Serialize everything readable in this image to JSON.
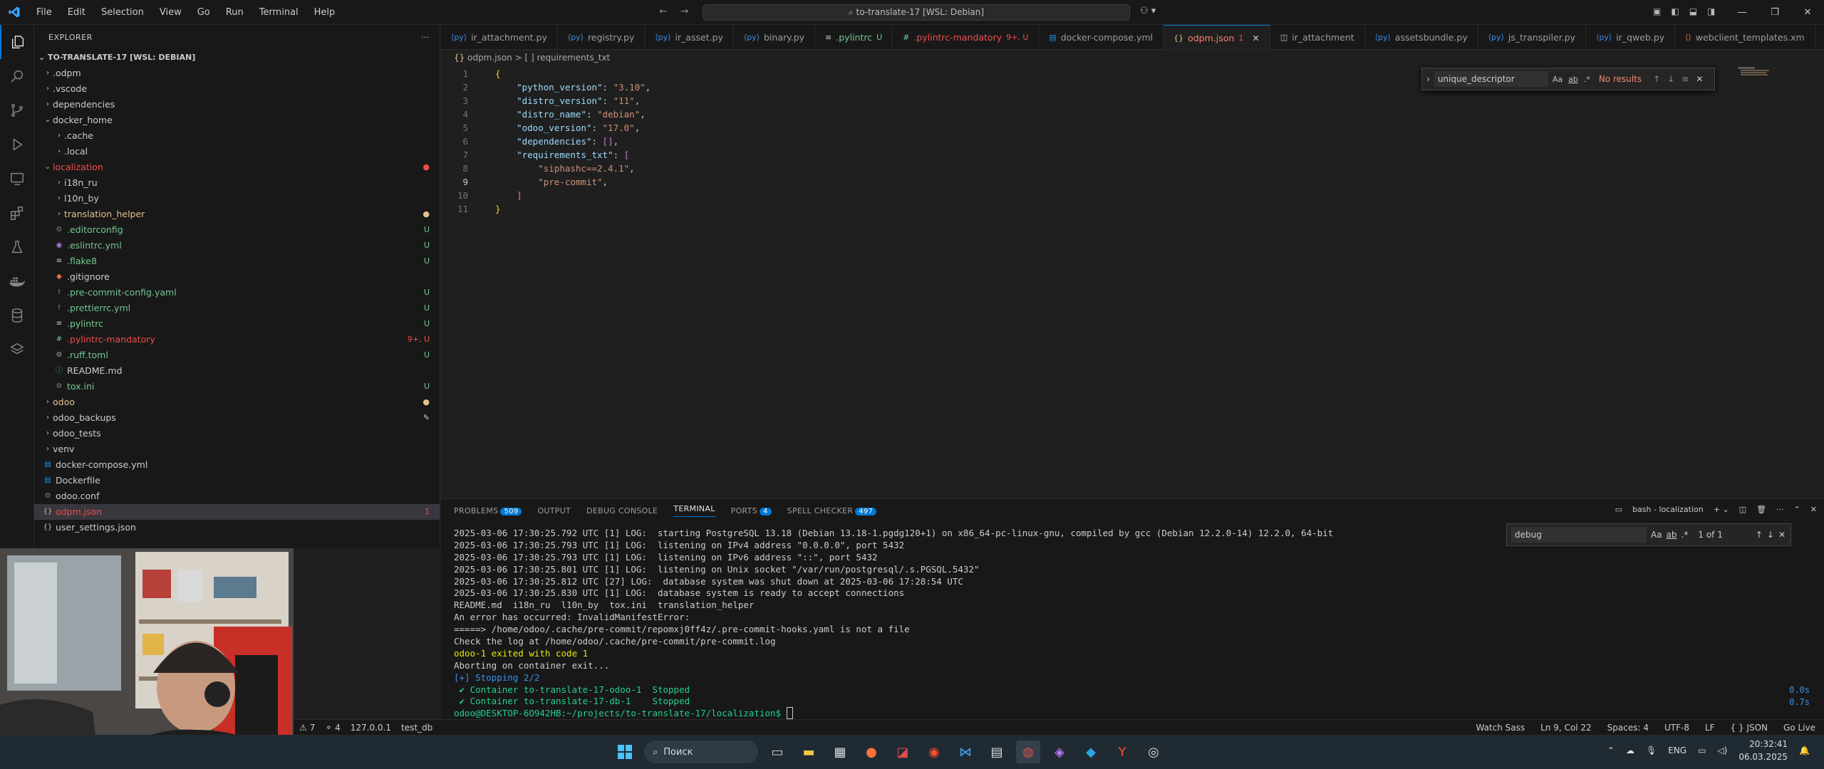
{
  "titlebar": {
    "menu": [
      "File",
      "Edit",
      "Selection",
      "View",
      "Go",
      "Run",
      "Terminal",
      "Help"
    ],
    "command_center": "to-translate-17 [WSL: Debian]"
  },
  "explorer": {
    "title": "EXPLORER",
    "root": "TO-TRANSLATE-17 [WSL: DEBIAN]",
    "items": [
      {
        "label": ".odpm",
        "indent": 1,
        "type": "folder",
        "open": false,
        "color": "white",
        "badge": ""
      },
      {
        "label": ".vscode",
        "indent": 1,
        "type": "folder",
        "open": false,
        "color": "white",
        "badge": ""
      },
      {
        "label": "dependencies",
        "indent": 1,
        "type": "folder",
        "open": false,
        "color": "white",
        "badge": ""
      },
      {
        "label": "docker_home",
        "indent": 1,
        "type": "folder",
        "open": true,
        "color": "white",
        "badge": ""
      },
      {
        "label": ".cache",
        "indent": 2,
        "type": "folder",
        "open": false,
        "color": "white",
        "badge": ""
      },
      {
        "label": ".local",
        "indent": 2,
        "type": "folder",
        "open": false,
        "color": "white",
        "badge": ""
      },
      {
        "label": "localization",
        "indent": 1,
        "type": "folder",
        "open": true,
        "color": "red",
        "badge": "●"
      },
      {
        "label": "i18n_ru",
        "indent": 2,
        "type": "folder",
        "open": false,
        "color": "white",
        "badge": ""
      },
      {
        "label": "l10n_by",
        "indent": 2,
        "type": "folder",
        "open": false,
        "color": "white",
        "badge": ""
      },
      {
        "label": "translation_helper",
        "indent": 2,
        "type": "folder",
        "open": false,
        "color": "yellow",
        "badge": "●"
      },
      {
        "label": ".editorconfig",
        "indent": 2,
        "type": "file",
        "color": "green",
        "badge": "U",
        "icon": "gear"
      },
      {
        "label": ".eslintrc.yml",
        "indent": 2,
        "type": "file",
        "color": "green",
        "badge": "U",
        "icon": "eslint"
      },
      {
        "label": ".flake8",
        "indent": 2,
        "type": "file",
        "color": "green",
        "badge": "U",
        "icon": "file"
      },
      {
        "label": ".gitignore",
        "indent": 2,
        "type": "file",
        "color": "white",
        "badge": "",
        "icon": "git"
      },
      {
        "label": ".pre-commit-config.yaml",
        "indent": 2,
        "type": "file",
        "color": "green",
        "badge": "U",
        "icon": "yaml"
      },
      {
        "label": ".prettierrc.yml",
        "indent": 2,
        "type": "file",
        "color": "green",
        "badge": "U",
        "icon": "yaml"
      },
      {
        "label": ".pylintrc",
        "indent": 2,
        "type": "file",
        "color": "green",
        "badge": "U",
        "icon": "file"
      },
      {
        "label": ".pylintrc-mandatory",
        "indent": 2,
        "type": "file",
        "color": "red",
        "badge": "9+, U",
        "icon": "hash"
      },
      {
        "label": ".ruff.toml",
        "indent": 2,
        "type": "file",
        "color": "green",
        "badge": "U",
        "icon": "toml"
      },
      {
        "label": "README.md",
        "indent": 2,
        "type": "file",
        "color": "white",
        "badge": "",
        "icon": "info"
      },
      {
        "label": "tox.ini",
        "indent": 2,
        "type": "file",
        "color": "green",
        "badge": "U",
        "icon": "gear"
      },
      {
        "label": "odoo",
        "indent": 1,
        "type": "folder",
        "open": false,
        "color": "yellow",
        "badge": "●"
      },
      {
        "label": "odoo_backups",
        "indent": 1,
        "type": "folder",
        "open": false,
        "color": "white",
        "badge": "✎"
      },
      {
        "label": "odoo_tests",
        "indent": 1,
        "type": "folder",
        "open": false,
        "color": "white",
        "badge": ""
      },
      {
        "label": "venv",
        "indent": 1,
        "type": "folder",
        "open": false,
        "color": "white",
        "badge": ""
      },
      {
        "label": "docker-compose.yml",
        "indent": 1,
        "type": "file",
        "color": "white",
        "badge": "",
        "icon": "docker"
      },
      {
        "label": "Dockerfile",
        "indent": 1,
        "type": "file",
        "color": "white",
        "badge": "",
        "icon": "docker"
      },
      {
        "label": "odoo.conf",
        "indent": 1,
        "type": "file",
        "color": "white",
        "badge": "",
        "icon": "gear"
      },
      {
        "label": "odpm.json",
        "indent": 1,
        "type": "file",
        "color": "red",
        "badge": "1",
        "icon": "json",
        "selected": true
      },
      {
        "label": "user_settings.json",
        "indent": 1,
        "type": "file",
        "color": "white",
        "badge": "",
        "icon": "json"
      }
    ]
  },
  "tabs": [
    {
      "label": "ir_attachment.py",
      "icon": "py",
      "color": "#9d9d9d",
      "suffix": ""
    },
    {
      "label": "registry.py",
      "icon": "py",
      "color": "#9d9d9d",
      "suffix": ""
    },
    {
      "label": "ir_asset.py",
      "icon": "py",
      "color": "#9d9d9d",
      "suffix": ""
    },
    {
      "label": "binary.py",
      "icon": "py",
      "color": "#9d9d9d",
      "suffix": ""
    },
    {
      "label": ".pylintrc",
      "icon": "file",
      "color": "#73c991",
      "suffix": "U"
    },
    {
      "label": ".pylintrc-mandatory",
      "icon": "hash",
      "color": "#f14c4c",
      "suffix": "9+, U"
    },
    {
      "label": "docker-compose.yml",
      "icon": "docker",
      "color": "#9d9d9d",
      "suffix": ""
    },
    {
      "label": "odpm.json",
      "icon": "json",
      "color": "#f14c4c",
      "suffix": "1",
      "active": true
    },
    {
      "label": "ir_attachment",
      "icon": "split",
      "color": "#9d9d9d",
      "suffix": ""
    },
    {
      "label": "assetsbundle.py",
      "icon": "py",
      "color": "#9d9d9d",
      "suffix": ""
    },
    {
      "label": "js_transpiler.py",
      "icon": "py",
      "color": "#9d9d9d",
      "suffix": ""
    },
    {
      "label": "ir_qweb.py",
      "icon": "py",
      "color": "#9d9d9d",
      "suffix": ""
    },
    {
      "label": "webclient_templates.xm",
      "icon": "xml",
      "color": "#9d9d9d",
      "suffix": ""
    }
  ],
  "breadcrumb": {
    "file": "odpm.json",
    "sep": ">",
    "path": "[ ] requirements_txt"
  },
  "code_lines": [
    "{",
    "    \"python_version\": \"3.10\",",
    "    \"distro_version\": \"11\",",
    "    \"distro_name\": \"debian\",",
    "    \"odoo_version\": \"17.0\",",
    "    \"dependencies\": [],",
    "    \"requirements_txt\": [",
    "        \"siphashc==2.4.1\",",
    "        \"pre-commit\",",
    "    ]",
    "}"
  ],
  "find": {
    "query": "unique_descriptor",
    "opt_case": "Aa",
    "opt_word": "ab",
    "opt_regex": ".*",
    "status": "No results"
  },
  "panel": {
    "tabs": [
      {
        "label": "PROBLEMS",
        "count": "509"
      },
      {
        "label": "OUTPUT",
        "count": ""
      },
      {
        "label": "DEBUG CONSOLE",
        "count": ""
      },
      {
        "label": "TERMINAL",
        "count": "",
        "active": true
      },
      {
        "label": "PORTS",
        "count": "4"
      },
      {
        "label": "SPELL CHECKER",
        "count": "497"
      }
    ],
    "terminal_name": "bash - localization",
    "find_query": "debug",
    "find_status": "1 of 1",
    "lines": [
      {
        "text": "2025-03-06 17:30:25.792 UTC [1] LOG:  starting PostgreSQL 13.18 (Debian 13.18-1.pgdg120+1) on x86_64-pc-linux-gnu, compiled by gcc (Debian 12.2.0-14) 12.2.0, 64-bit",
        "color": ""
      },
      {
        "text": "2025-03-06 17:30:25.793 UTC [1] LOG:  listening on IPv4 address \"0.0.0.0\", port 5432",
        "color": ""
      },
      {
        "text": "2025-03-06 17:30:25.793 UTC [1] LOG:  listening on IPv6 address \"::\", port 5432",
        "color": ""
      },
      {
        "text": "2025-03-06 17:30:25.801 UTC [1] LOG:  listening on Unix socket \"/var/run/postgresql/.s.PGSQL.5432\"",
        "color": ""
      },
      {
        "text": "2025-03-06 17:30:25.812 UTC [27] LOG:  database system was shut down at 2025-03-06 17:28:54 UTC",
        "color": ""
      },
      {
        "text": "2025-03-06 17:30:25.830 UTC [1] LOG:  database system is ready to accept connections",
        "color": ""
      },
      {
        "text": "README.md  i18n_ru  l10n_by  tox.ini  translation_helper",
        "color": ""
      },
      {
        "text": "An error has occurred: InvalidManifestError:",
        "color": ""
      },
      {
        "text": "=====> /home/odoo/.cache/pre-commit/repomxj0ff4z/.pre-commit-hooks.yaml is not a file",
        "color": ""
      },
      {
        "text": "Check the log at /home/odoo/.cache/pre-commit/pre-commit.log",
        "color": ""
      },
      {
        "text": "odoo-1 exited with code 1",
        "color": "yellow"
      },
      {
        "text": "Aborting on container exit...",
        "color": ""
      },
      {
        "text": "[+] Stopping 2/2",
        "color": "blue"
      },
      {
        "text": " ✔ Container to-translate-17-odoo-1  Stopped",
        "color": "green"
      },
      {
        "text": " ✔ Container to-translate-17-db-1    Stopped",
        "color": "green"
      },
      {
        "text": "odoo@DESKTOP-6O942HB:~/projects/to-translate-17/localization$ ",
        "color": "prompt"
      }
    ],
    "timings": [
      "0.0s",
      "0.7s"
    ]
  },
  "statusbar": {
    "left": [
      "⚠ 7",
      "⚬ 4",
      "127.0.0.1",
      "test_db"
    ],
    "right": [
      "Watch Sass",
      "Ln 9, Col 22",
      "Spaces: 4",
      "UTF-8",
      "LF",
      "{ } JSON",
      "Go Live"
    ]
  },
  "taskbar": {
    "search_label": "Поиск",
    "lang": "ENG",
    "time": "20:32:41",
    "date": "06.03.2025"
  },
  "colors": {
    "accent": "#0078d4",
    "error": "#f14c4c",
    "untracked": "#73c991"
  }
}
